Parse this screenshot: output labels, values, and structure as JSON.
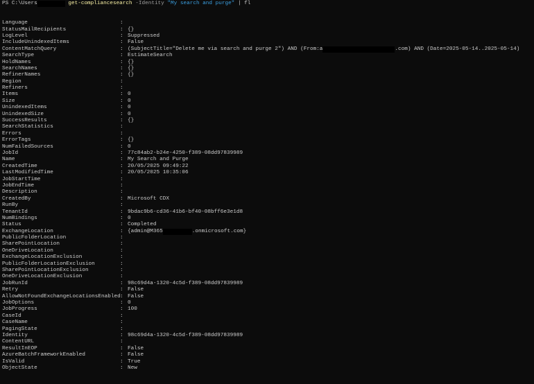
{
  "prompt": {
    "prefix": "PS C:\\Users",
    "command": "get-compliancesearch",
    "param": "-Identity",
    "argument": "\"My search and purge\"",
    "pipe": "| fl"
  },
  "rows": [
    {
      "key": "Language",
      "value": ""
    },
    {
      "key": "StatusMailRecipients",
      "value": "{}"
    },
    {
      "key": "LogLevel",
      "value": "Suppressed"
    },
    {
      "key": "IncludeUnindexedItems",
      "value": "False"
    },
    {
      "key": "ContentMatchQuery",
      "value": "(SubjectTitle=\"Delete me via search and purge 2\") AND (From:a",
      "redacted": true,
      "value_after": ".com) AND (Date=2025-05-14..2025-05-14)"
    },
    {
      "key": "SearchType",
      "value": "EstimateSearch"
    },
    {
      "key": "HoldNames",
      "value": "{}"
    },
    {
      "key": "SearchNames",
      "value": "{}"
    },
    {
      "key": "RefinerNames",
      "value": "{}"
    },
    {
      "key": "Region",
      "value": ""
    },
    {
      "key": "Refiners",
      "value": ""
    },
    {
      "key": "Items",
      "value": "0"
    },
    {
      "key": "Size",
      "value": "0"
    },
    {
      "key": "UnindexedItems",
      "value": "0"
    },
    {
      "key": "UnindexedSize",
      "value": "0"
    },
    {
      "key": "SuccessResults",
      "value": "{}"
    },
    {
      "key": "SearchStatistics",
      "value": ""
    },
    {
      "key": "Errors",
      "value": ""
    },
    {
      "key": "ErrorTags",
      "value": "{}"
    },
    {
      "key": "NumFailedSources",
      "value": "0"
    },
    {
      "key": "JobId",
      "value": "77c84ab2-b24e-4250-f389-08dd97839989"
    },
    {
      "key": "Name",
      "value": "My Search and Purge"
    },
    {
      "key": "CreatedTime",
      "value": "20/05/2025 09:49:22"
    },
    {
      "key": "LastModifiedTime",
      "value": "20/05/2025 10:35:06"
    },
    {
      "key": "JobStartTime",
      "value": ""
    },
    {
      "key": "JobEndTime",
      "value": ""
    },
    {
      "key": "Description",
      "value": ""
    },
    {
      "key": "CreatedBy",
      "value": "Microsoft CDX"
    },
    {
      "key": "RunBy",
      "value": ""
    },
    {
      "key": "TenantId",
      "value": "9bdac9b6-cd36-41b6-bf40-08bff6e3e1d8"
    },
    {
      "key": "NumBindings",
      "value": "0"
    },
    {
      "key": "Status",
      "value": "Completed"
    },
    {
      "key": "ExchangeLocation",
      "value": "{admin@M365",
      "redacted": true,
      "value_after": ".onmicrosoft.com}"
    },
    {
      "key": "PublicFolderLocation",
      "value": ""
    },
    {
      "key": "SharePointLocation",
      "value": ""
    },
    {
      "key": "OneDriveLocation",
      "value": ""
    },
    {
      "key": "ExchangeLocationExclusion",
      "value": ""
    },
    {
      "key": "PublicFolderLocationExclusion",
      "value": ""
    },
    {
      "key": "SharePointLocationExclusion",
      "value": ""
    },
    {
      "key": "OneDriveLocationExclusion",
      "value": ""
    },
    {
      "key": "JobRunId",
      "value": "98c69d4a-1320-4c5d-f389-08dd97839989"
    },
    {
      "key": "Retry",
      "value": "False"
    },
    {
      "key": "AllowNotFoundExchangeLocationsEnabled",
      "value": "False"
    },
    {
      "key": "JobOptions",
      "value": "0"
    },
    {
      "key": "JobProgress",
      "value": "100"
    },
    {
      "key": "CaseId",
      "value": ""
    },
    {
      "key": "CaseName",
      "value": ""
    },
    {
      "key": "PagingState",
      "value": ""
    },
    {
      "key": "Identity",
      "value": "98c69d4a-1320-4c5d-f389-08dd97839989"
    },
    {
      "key": "ContentURL",
      "value": ""
    },
    {
      "key": "ResultInEOP",
      "value": "False"
    },
    {
      "key": "AzureBatchFrameworkEnabled",
      "value": "False"
    },
    {
      "key": "IsValid",
      "value": "True"
    },
    {
      "key": "ObjectState",
      "value": "New"
    }
  ]
}
